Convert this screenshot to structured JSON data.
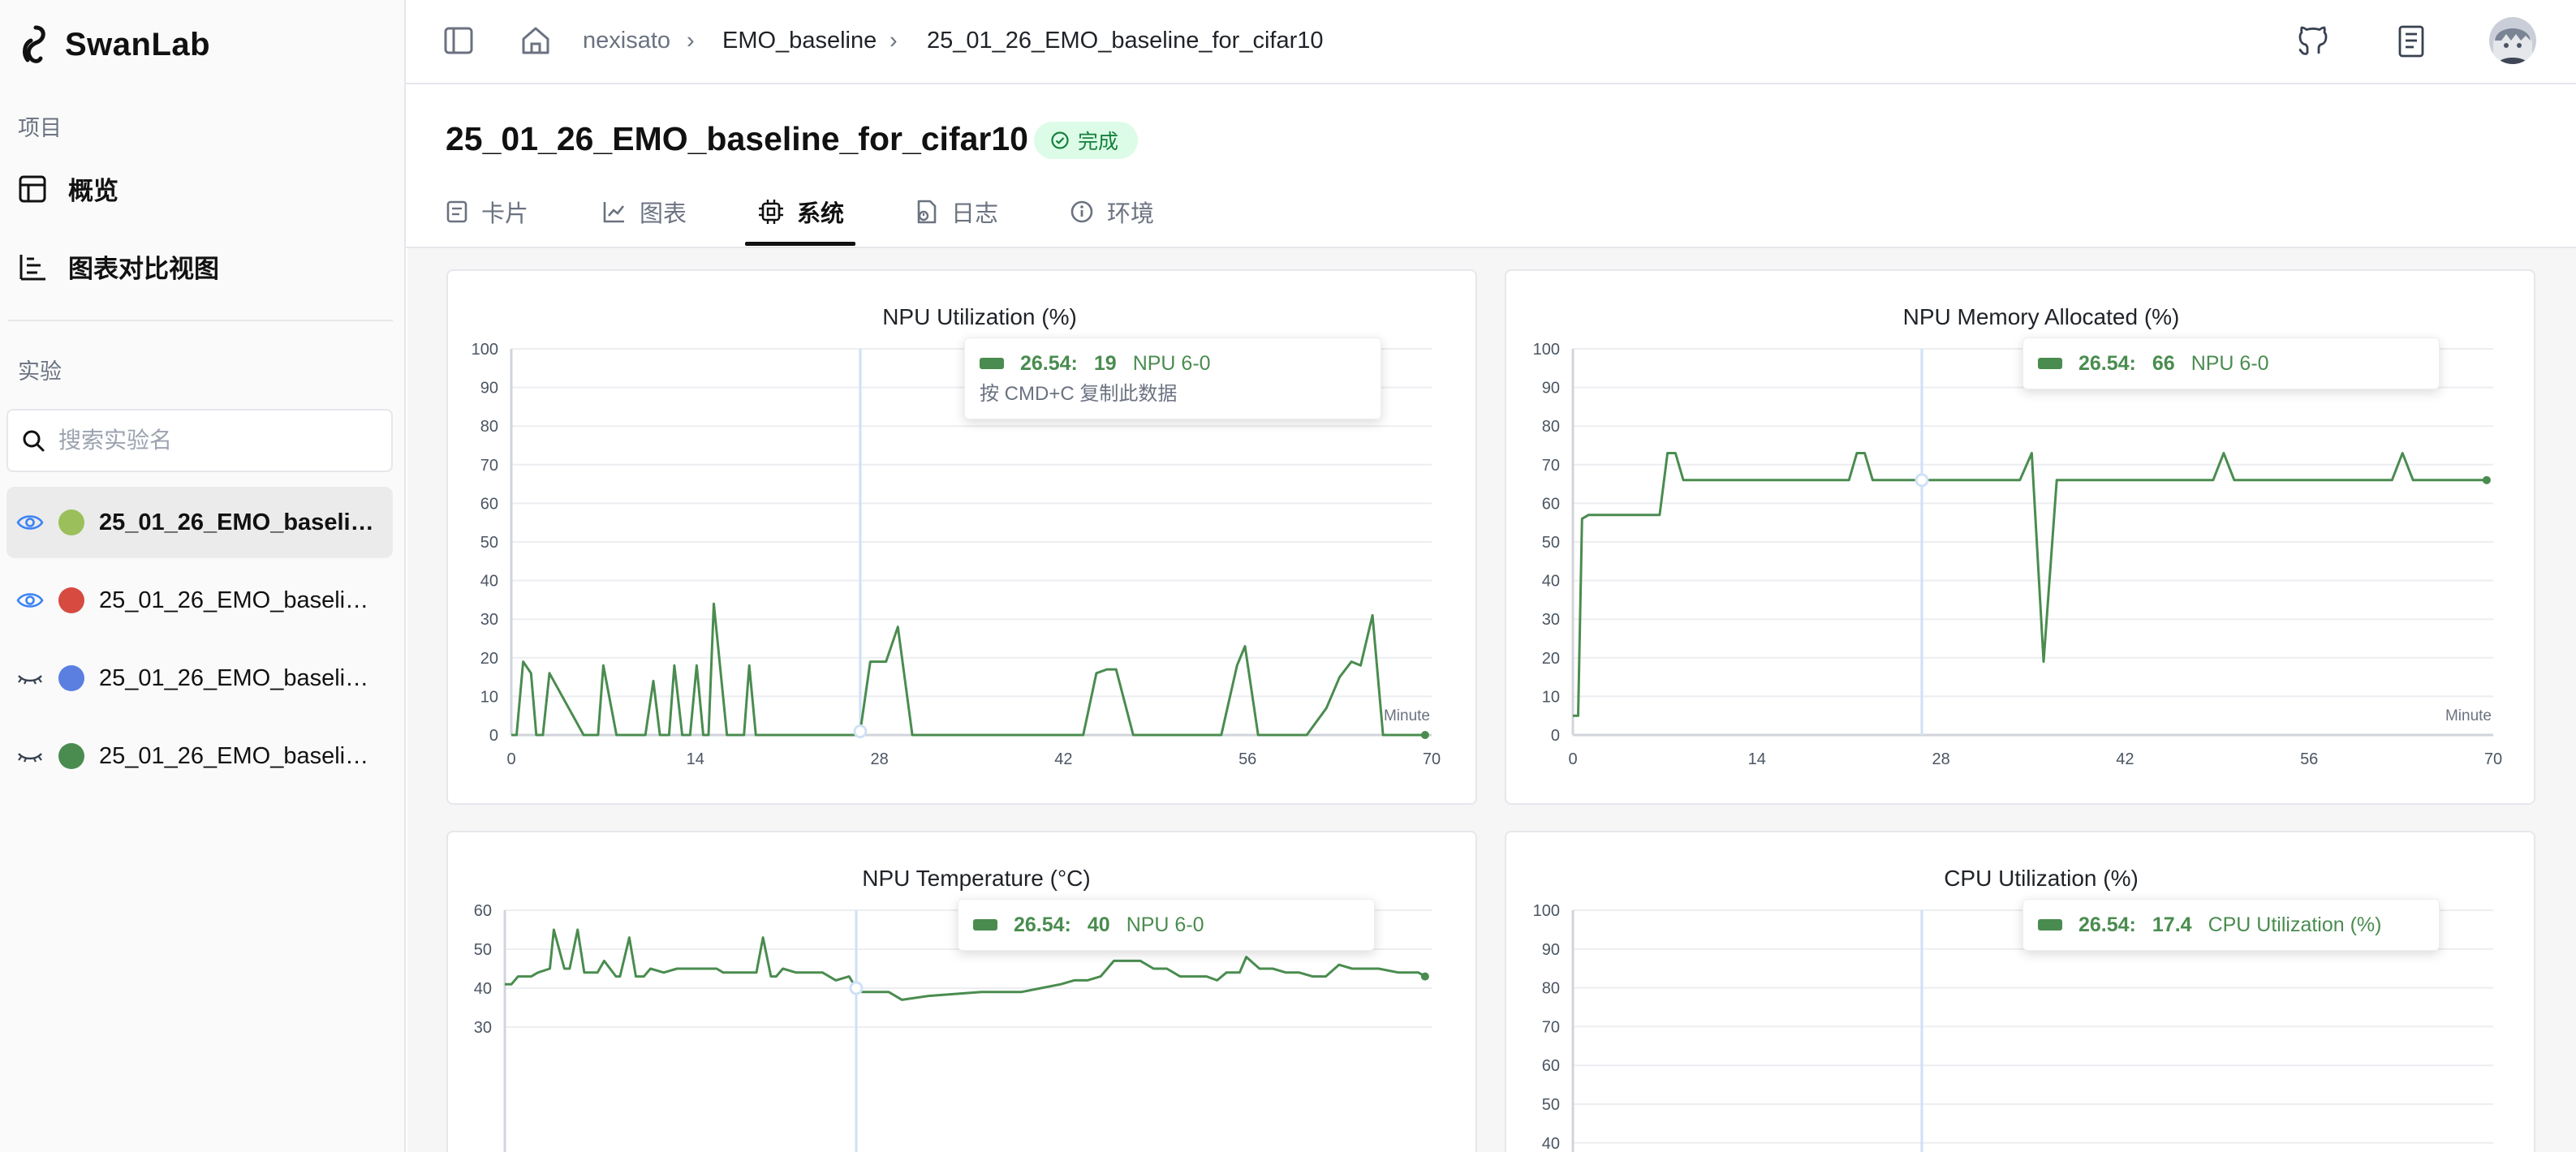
{
  "app": {
    "name": "SwanLab"
  },
  "sidebar": {
    "project_label": "项目",
    "nav": [
      {
        "label": "概览",
        "icon": "table-icon"
      },
      {
        "label": "图表对比视图",
        "icon": "bar-chart-icon"
      }
    ],
    "experiments_label": "实验",
    "search_placeholder": "搜索实验名",
    "experiments": [
      {
        "name": "25_01_26_EMO_baselin…",
        "color": "#9bbf5a",
        "visible": true,
        "active": true
      },
      {
        "name": "25_01_26_EMO_baselin…",
        "color": "#d64a40",
        "visible": true,
        "active": false
      },
      {
        "name": "25_01_26_EMO_baselin…",
        "color": "#5b7fe0",
        "visible": false,
        "active": false
      },
      {
        "name": "25_01_26_EMO_baselin…",
        "color": "#4a8c4f",
        "visible": false,
        "active": false
      }
    ]
  },
  "header": {
    "breadcrumb": [
      "nexisato",
      "EMO_baseline",
      "25_01_26_EMO_baseline_for_cifar10"
    ]
  },
  "page": {
    "title": "25_01_26_EMO_baseline_for_cifar10",
    "status": "完成",
    "tabs": [
      {
        "label": "卡片",
        "icon": "card-icon"
      },
      {
        "label": "图表",
        "icon": "line-chart-icon"
      },
      {
        "label": "系统",
        "icon": "cpu-icon",
        "active": true
      },
      {
        "label": "日志",
        "icon": "log-icon"
      },
      {
        "label": "环境",
        "icon": "info-icon"
      }
    ]
  },
  "chart_data": [
    {
      "type": "line",
      "title": "NPU Utilization (%)",
      "xlabel": "Minute",
      "xlim": [
        0,
        70
      ],
      "ylim": [
        0,
        100
      ],
      "xticks": [
        0,
        14,
        28,
        42,
        56,
        70
      ],
      "yticks": [
        0,
        10,
        20,
        30,
        40,
        50,
        60,
        70,
        80,
        90,
        100
      ],
      "series": [
        {
          "name": "NPU 6-0",
          "x": [
            0,
            0.4,
            0.9,
            1.5,
            1.9,
            2.4,
            2.9,
            5.5,
            6.6,
            7.0,
            8.0,
            10.2,
            10.8,
            11.3,
            12.0,
            12.4,
            13.0,
            13.6,
            14.1,
            14.6,
            15.0,
            15.4,
            16.4,
            17.7,
            18.1,
            18.6,
            19.5,
            23.0,
            25.5,
            26.5,
            27.3,
            28.0,
            28.5,
            29.4,
            30.5,
            40.0,
            43.5,
            44.5,
            45.3,
            46.0,
            47.3,
            52.5,
            54.0,
            55.2,
            55.8,
            56.8,
            60.5,
            62.0,
            63.0,
            63.9,
            64.6,
            65.5,
            66.3,
            66.8,
            68.5,
            69.5
          ],
          "y": [
            0,
            0,
            19,
            16,
            0,
            0,
            16,
            0,
            0,
            18,
            0,
            0,
            14,
            0,
            0,
            18,
            0,
            0,
            18,
            0,
            0,
            34,
            0,
            0,
            18,
            0,
            0,
            0,
            0,
            0,
            19,
            19,
            19,
            28,
            0,
            0,
            0,
            16,
            17,
            17,
            0,
            0,
            0,
            18,
            23,
            0,
            0,
            7,
            15,
            19,
            18,
            31,
            0,
            0,
            0,
            0
          ]
        }
      ],
      "cursor_x": 26.54,
      "tooltip": {
        "x_label": "26.54:",
        "value": "19",
        "series": "NPU 6-0",
        "hint": "按 CMD+C 复制此数据"
      }
    },
    {
      "type": "line",
      "title": "NPU Memory Allocated (%)",
      "xlabel": "Minute",
      "xlim": [
        0,
        70
      ],
      "ylim": [
        0,
        100
      ],
      "xticks": [
        0,
        14,
        28,
        42,
        56,
        70
      ],
      "yticks": [
        0,
        10,
        20,
        30,
        40,
        50,
        60,
        70,
        80,
        90,
        100
      ],
      "series": [
        {
          "name": "NPU 6-0",
          "x": [
            0,
            0.4,
            0.7,
            1.2,
            6.6,
            7.2,
            7.8,
            8.4,
            21.0,
            21.6,
            22.2,
            22.8,
            34.0,
            34.9,
            35.8,
            36.8,
            48.7,
            49.5,
            50.3,
            62.3,
            63.1,
            63.9,
            69.5
          ],
          "y": [
            5,
            5,
            56,
            57,
            57,
            73,
            73,
            66,
            66,
            73,
            73,
            66,
            66,
            73,
            19,
            66,
            66,
            73,
            66,
            66,
            73,
            66,
            66
          ]
        }
      ],
      "cursor_x": 26.54,
      "tooltip": {
        "x_label": "26.54:",
        "value": "66",
        "series": "NPU 6-0"
      }
    },
    {
      "type": "line",
      "title": "NPU Temperature (°C)",
      "ylim": [
        25,
        60
      ],
      "yticks": [
        30,
        40,
        50,
        60
      ],
      "xlim": [
        0,
        70
      ],
      "series": [
        {
          "name": "NPU 6-0",
          "x": [
            0,
            0.5,
            1.0,
            2.0,
            2.5,
            3.4,
            3.7,
            4.5,
            4.9,
            5.5,
            6.0,
            7.0,
            7.5,
            8.4,
            8.7,
            9.4,
            9.9,
            10.5,
            11.0,
            12.0,
            13.0,
            15.0,
            16.0,
            16.5,
            18.0,
            19.0,
            19.5,
            20.1,
            20.5,
            21.0,
            22.0,
            24.0,
            25.0,
            26.0,
            26.54,
            27.0,
            29.0,
            30.0,
            32.0,
            36.0,
            39.0,
            40.5,
            42.0,
            43.0,
            44.0,
            45.0,
            46.0,
            48.0,
            49.0,
            50.0,
            51.0,
            53.0,
            53.8,
            54.5,
            55.5,
            56.0,
            57.0,
            58.0,
            59.0,
            60.0,
            61.0,
            62.0,
            63.0,
            64.0,
            65.0,
            66.0,
            67.5,
            69.0,
            69.5
          ],
          "y": [
            41,
            41,
            43,
            43,
            44,
            45,
            55,
            45,
            45,
            55,
            44,
            44,
            47,
            43,
            43,
            53,
            43,
            43,
            45,
            44,
            45,
            45,
            45,
            44,
            44,
            44,
            53,
            43,
            43,
            45,
            44,
            44,
            42,
            43,
            40,
            39,
            39,
            37,
            38,
            39,
            39,
            40,
            41,
            42,
            42,
            43,
            47,
            47,
            45,
            45,
            43,
            43,
            42,
            44,
            44,
            48,
            45,
            45,
            44,
            44,
            43,
            43,
            46,
            45,
            45,
            45,
            44,
            44,
            43
          ]
        }
      ],
      "cursor_x": 26.54,
      "tooltip": {
        "x_label": "26.54:",
        "value": "40",
        "series": "NPU 6-0"
      }
    },
    {
      "type": "line",
      "title": "CPU Utilization (%)",
      "ylim": [
        0,
        100
      ],
      "yticks": [
        40,
        50,
        60,
        70,
        80,
        90,
        100
      ],
      "xlim": [
        0,
        70
      ],
      "series": [
        {
          "name": "CPU Utilization (%)",
          "x": [],
          "y": []
        }
      ],
      "cursor_x": 26.54,
      "tooltip": {
        "x_label": "26.54:",
        "value": "17.4",
        "series": "CPU Utilization (%)"
      }
    }
  ],
  "colors": {
    "series": "#4a8c4f",
    "cursor": "#cfe1f5",
    "grid": "#eceef1"
  }
}
